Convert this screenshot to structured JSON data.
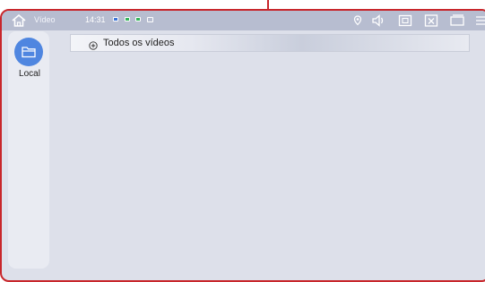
{
  "status_bar": {
    "app_title": "Vídeo",
    "time": "14:31",
    "notifications": [
      "blue",
      "green",
      "green",
      "outline"
    ],
    "icons": [
      "home-icon",
      "location-icon",
      "volume-icon",
      "screenshot-icon",
      "close-window-icon",
      "window-icon",
      "menu-icon"
    ]
  },
  "sidebar": {
    "items": [
      {
        "label": "Local",
        "icon": "folder-icon"
      }
    ]
  },
  "list": {
    "header_label": "Todos os vídeos",
    "header_icon": "plus-circle-icon"
  },
  "colors": {
    "frame": "#c8262b",
    "accent": "#4f86e0",
    "background": "#dde0ea"
  }
}
